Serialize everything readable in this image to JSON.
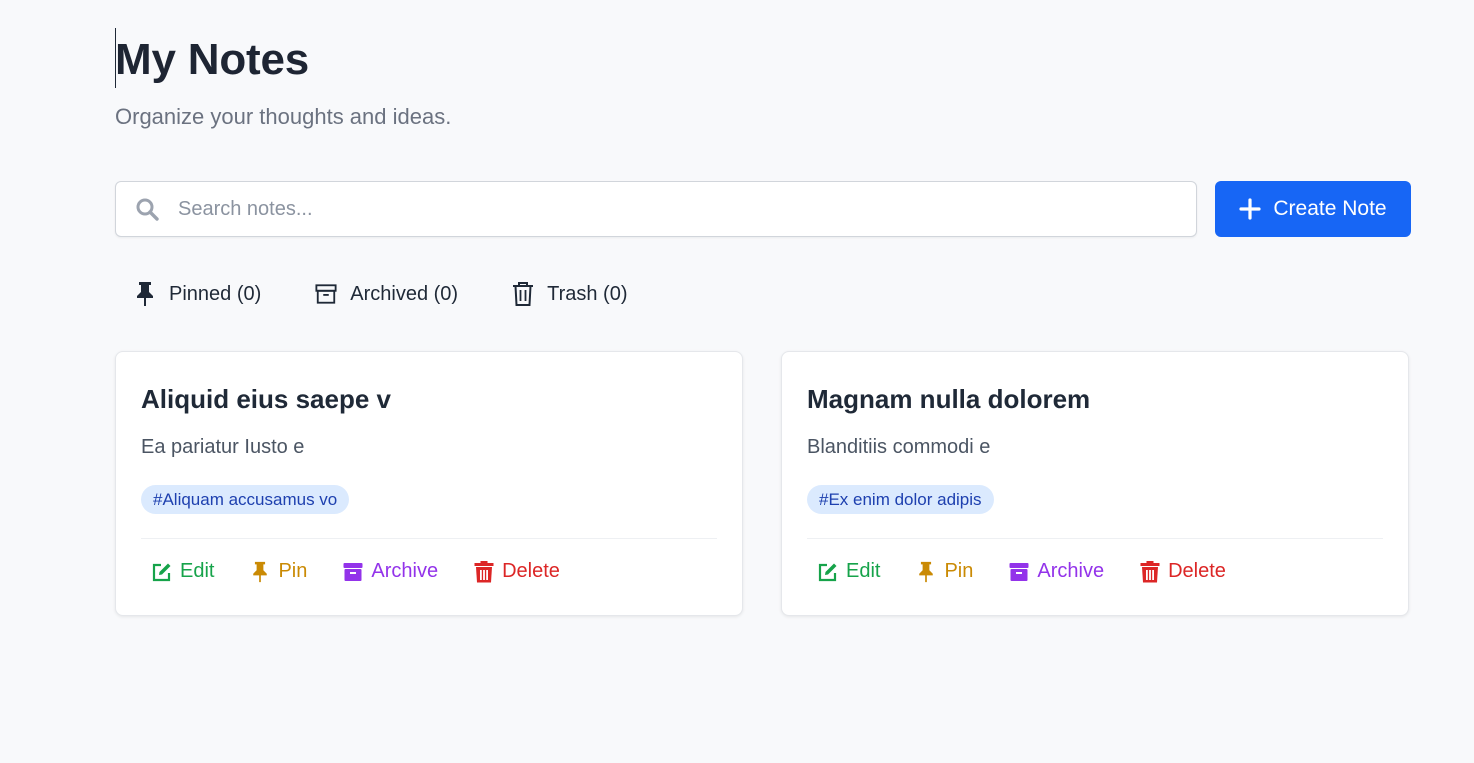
{
  "header": {
    "title": "My Notes",
    "subtitle": "Organize your thoughts and ideas."
  },
  "search": {
    "placeholder": "Search notes...",
    "value": "",
    "icon": "search-icon"
  },
  "create_button": {
    "label": "Create Note",
    "icon": "plus-icon",
    "color": "#1766f5"
  },
  "filters": [
    {
      "label": "Pinned (0)",
      "icon": "pin-icon"
    },
    {
      "label": "Archived (0)",
      "icon": "archive-box-icon"
    },
    {
      "label": "Trash (0)",
      "icon": "trash-icon"
    }
  ],
  "notes": [
    {
      "title": "Aliquid eius saepe v",
      "body": "Ea pariatur Iusto e",
      "tag": "#Aliquam accusamus vo"
    },
    {
      "title": "Magnam nulla dolorem",
      "body": "Blanditiis commodi e",
      "tag": "#Ex enim dolor adipis"
    }
  ],
  "actions": {
    "edit": "Edit",
    "pin": "Pin",
    "archive": "Archive",
    "delete": "Delete"
  },
  "colors": {
    "edit": "#16a34a",
    "pin": "#ca8a04",
    "archive": "#9333ea",
    "delete": "#dc2626",
    "tag_bg": "#dbeafe",
    "tag_text": "#1e40af"
  }
}
